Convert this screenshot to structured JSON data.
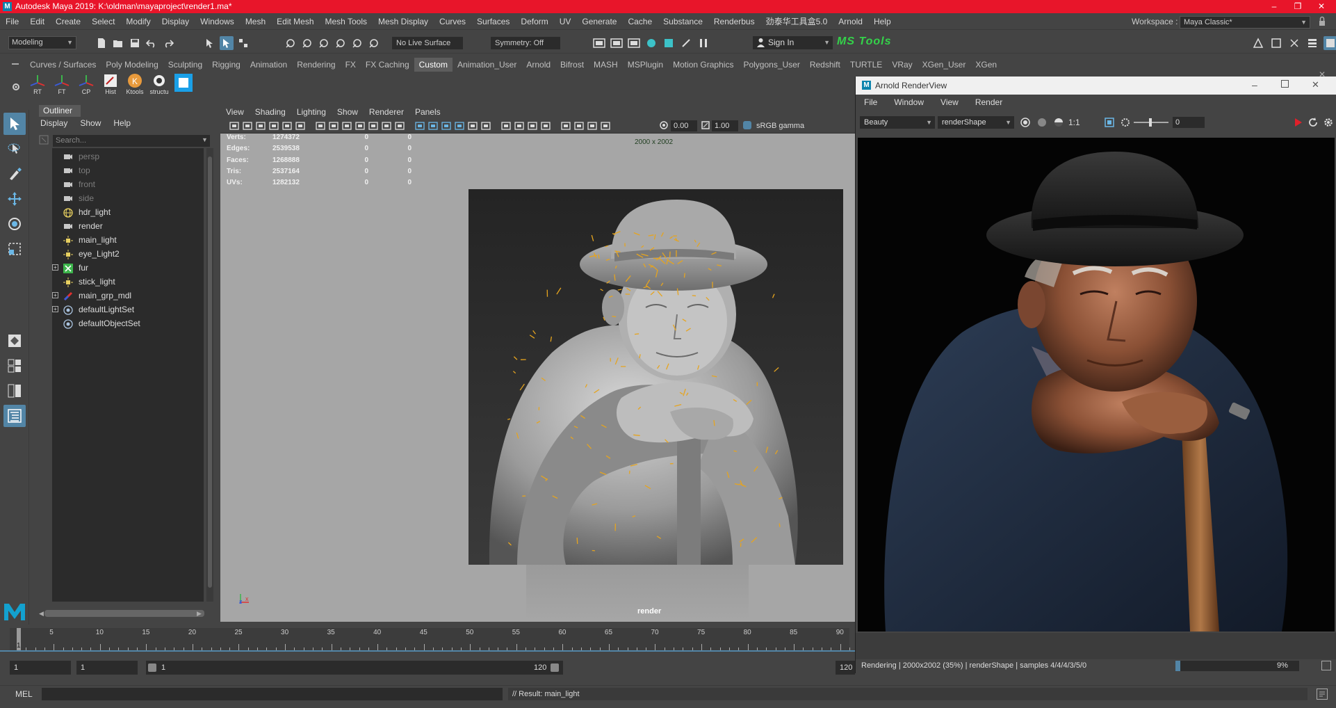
{
  "titlebar": {
    "title": "Autodesk Maya 2019: K:\\oldman\\mayaproject\\render1.ma*",
    "logo": "M",
    "minimize": "–",
    "restore": "❐",
    "close": "✕"
  },
  "menubar": {
    "items": [
      "File",
      "Edit",
      "Create",
      "Select",
      "Modify",
      "Display",
      "Windows",
      "Mesh",
      "Edit Mesh",
      "Mesh Tools",
      "Mesh Display",
      "Curves",
      "Surfaces",
      "Deform",
      "UV",
      "Generate",
      "Cache",
      "Substance",
      "Renderbus",
      "劲泰华工具盒5.0",
      "Arnold",
      "Help"
    ],
    "workspace_label": "Workspace :",
    "workspace_value": "Maya Classic*"
  },
  "statusline": {
    "mode": "Modeling",
    "live_surface": "No Live Surface",
    "symmetry": "Symmetry: Off",
    "sign_in": "Sign In",
    "ms_tools": "MS Tools"
  },
  "shelf": {
    "tabs": [
      "Curves / Surfaces",
      "Poly Modeling",
      "Sculpting",
      "Rigging",
      "Animation",
      "Rendering",
      "FX",
      "FX Caching",
      "Custom",
      "Animation_User",
      "Arnold",
      "Bifrost",
      "MASH",
      "MSPlugin",
      "Motion Graphics",
      "Polygons_User",
      "Redshift",
      "TURTLE",
      "VRay",
      "XGen_User",
      "XGen"
    ],
    "active_tab": "Custom",
    "icons": [
      {
        "label": "RT",
        "icon": "transform-icon"
      },
      {
        "label": "FT",
        "icon": "transform-icon"
      },
      {
        "label": "CP",
        "icon": "transform-icon"
      },
      {
        "label": "Hist",
        "icon": "history-icon"
      },
      {
        "label": "Ktools",
        "icon": "ktools-icon"
      },
      {
        "label": "structu",
        "icon": "python-icon"
      },
      {
        "label": "",
        "icon": "window-icon"
      }
    ]
  },
  "outliner": {
    "tab": "Outliner",
    "menu": [
      "Display",
      "Show",
      "Help"
    ],
    "search_placeholder": "Search...",
    "items": [
      {
        "name": "persp",
        "icon": "camera-icon",
        "dim": true,
        "expand": ""
      },
      {
        "name": "top",
        "icon": "camera-icon",
        "dim": true,
        "expand": ""
      },
      {
        "name": "front",
        "icon": "camera-icon",
        "dim": true,
        "expand": ""
      },
      {
        "name": "side",
        "icon": "camera-icon",
        "dim": true,
        "expand": ""
      },
      {
        "name": "hdr_light",
        "icon": "globe-light-icon",
        "dim": false,
        "expand": ""
      },
      {
        "name": "render",
        "icon": "camera-icon",
        "dim": false,
        "expand": ""
      },
      {
        "name": "main_light",
        "icon": "area-light-icon",
        "dim": false,
        "expand": ""
      },
      {
        "name": "eye_Light2",
        "icon": "area-light-icon",
        "dim": false,
        "expand": ""
      },
      {
        "name": "fur",
        "icon": "xgen-icon",
        "dim": false,
        "expand": "+"
      },
      {
        "name": "stick_light",
        "icon": "area-light-icon",
        "dim": false,
        "expand": ""
      },
      {
        "name": "main_grp_mdl",
        "icon": "mesh-group-icon",
        "dim": false,
        "expand": "+"
      },
      {
        "name": "defaultLightSet",
        "icon": "set-icon",
        "dim": false,
        "expand": "+"
      },
      {
        "name": "defaultObjectSet",
        "icon": "set-icon",
        "dim": false,
        "expand": ""
      }
    ]
  },
  "viewport": {
    "menu": [
      "View",
      "Shading",
      "Lighting",
      "Show",
      "Renderer",
      "Panels"
    ],
    "exposure": "0.00",
    "gamma": "1.00",
    "color_space": "sRGB gamma",
    "hud": [
      {
        "k": "Verts:",
        "v1": "1274372",
        "v2": "0",
        "v3": "0"
      },
      {
        "k": "Edges:",
        "v1": "2539538",
        "v2": "0",
        "v3": "0"
      },
      {
        "k": "Faces:",
        "v1": "1268888",
        "v2": "0",
        "v3": "0"
      },
      {
        "k": "Tris:",
        "v1": "2537164",
        "v2": "0",
        "v3": "0"
      },
      {
        "k": "UVs:",
        "v1": "1282132",
        "v2": "0",
        "v3": "0"
      }
    ],
    "resolution": "2000 x 2002",
    "camera": "render",
    "axis_x": "x",
    "axis_z": "z"
  },
  "renderview": {
    "title": "Arnold RenderView",
    "logo": "M",
    "menu": [
      "File",
      "Window",
      "View",
      "Render"
    ],
    "aov": "Beauty",
    "camera": "renderShape",
    "ratio": "1:1",
    "exposure": "0",
    "status": "Rendering | 2000x2002 (35%) | renderShape  | samples 4/4/4/3/5/0",
    "zoom": "9%"
  },
  "timeline": {
    "ticks": [
      "5",
      "10",
      "15",
      "20",
      "25",
      "30",
      "35",
      "40",
      "45",
      "50",
      "55",
      "60",
      "65",
      "70",
      "75",
      "80",
      "85",
      "90"
    ],
    "current": "1",
    "start": "1",
    "start2": "1",
    "range_start": "1",
    "range_end": "120",
    "end": "120"
  },
  "cmdline": {
    "lang": "MEL",
    "result": "// Result: main_light"
  },
  "colors": {
    "titlebar": "#e8152a",
    "active": "#5285a6",
    "panel": "#444444",
    "field": "#2b2b2b"
  }
}
